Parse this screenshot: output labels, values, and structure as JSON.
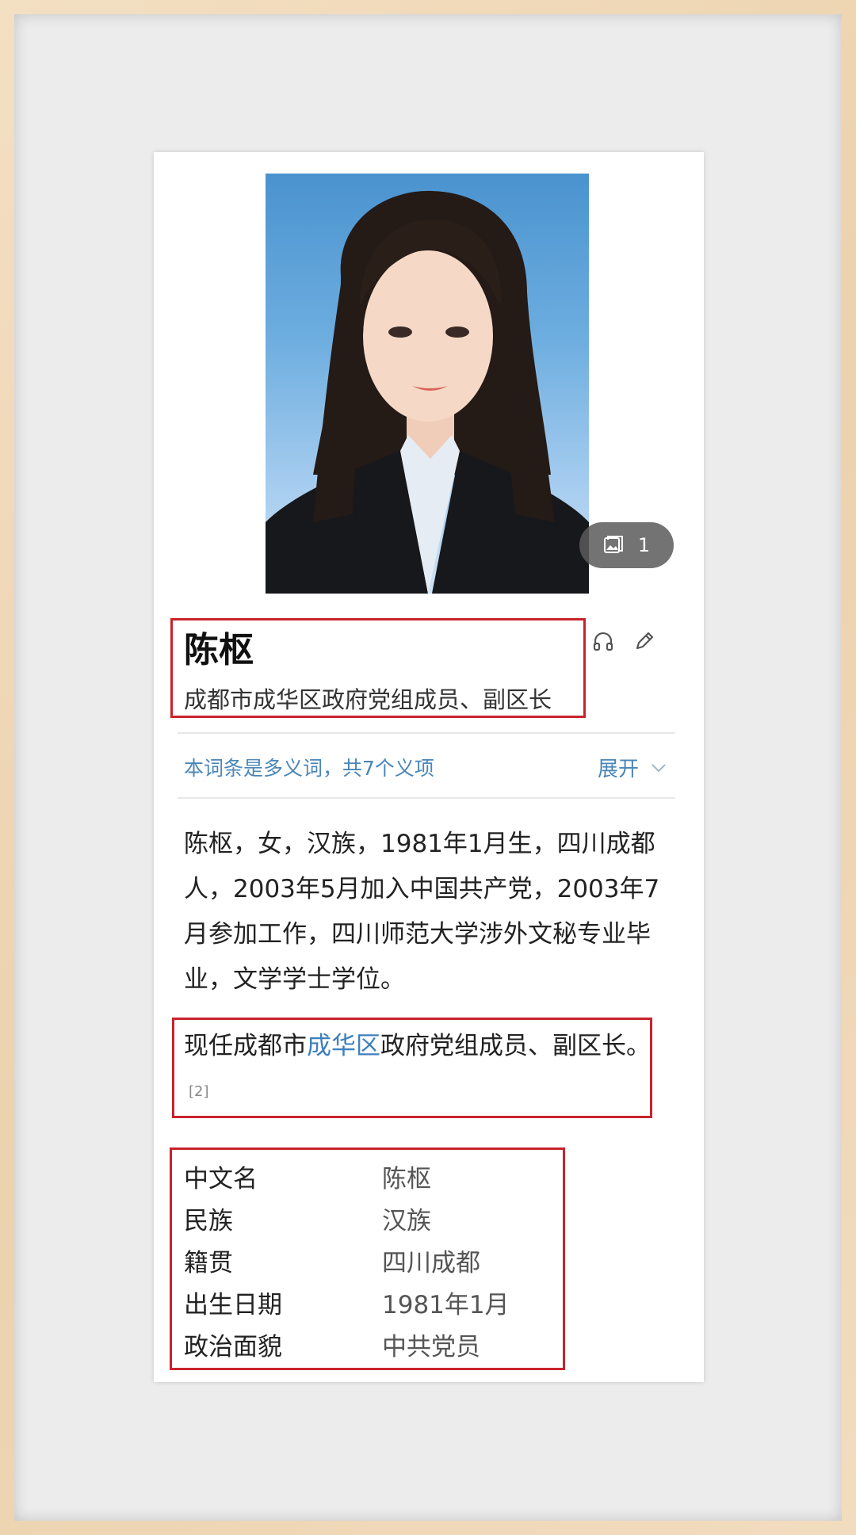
{
  "photo": {
    "count": "1"
  },
  "header": {
    "name": "陈枢",
    "subtitle": "成都市成华区政府党组成员、副区长"
  },
  "polysemy": {
    "text": "本词条是多义词，共7个义项",
    "expand_label": "展开"
  },
  "summary": "陈枢，女，汉族，1981年1月生，四川成都人，2003年5月加入中国共产党，2003年7月参加工作，四川师范大学涉外文秘专业毕业，文学学士学位。",
  "current": {
    "prefix": "现任成都市",
    "link": "成华区",
    "suffix": "政府党组成员、副区长。",
    "ref": "[2]"
  },
  "info": [
    {
      "key": "中文名",
      "value": "陈枢"
    },
    {
      "key": "民族",
      "value": "汉族"
    },
    {
      "key": "籍贯",
      "value": "四川成都"
    },
    {
      "key": "出生日期",
      "value": "1981年1月"
    },
    {
      "key": "政治面貌",
      "value": "中共党员"
    }
  ],
  "colors": {
    "accent_link": "#3e7fbd",
    "highlight_border": "#c8232c"
  }
}
